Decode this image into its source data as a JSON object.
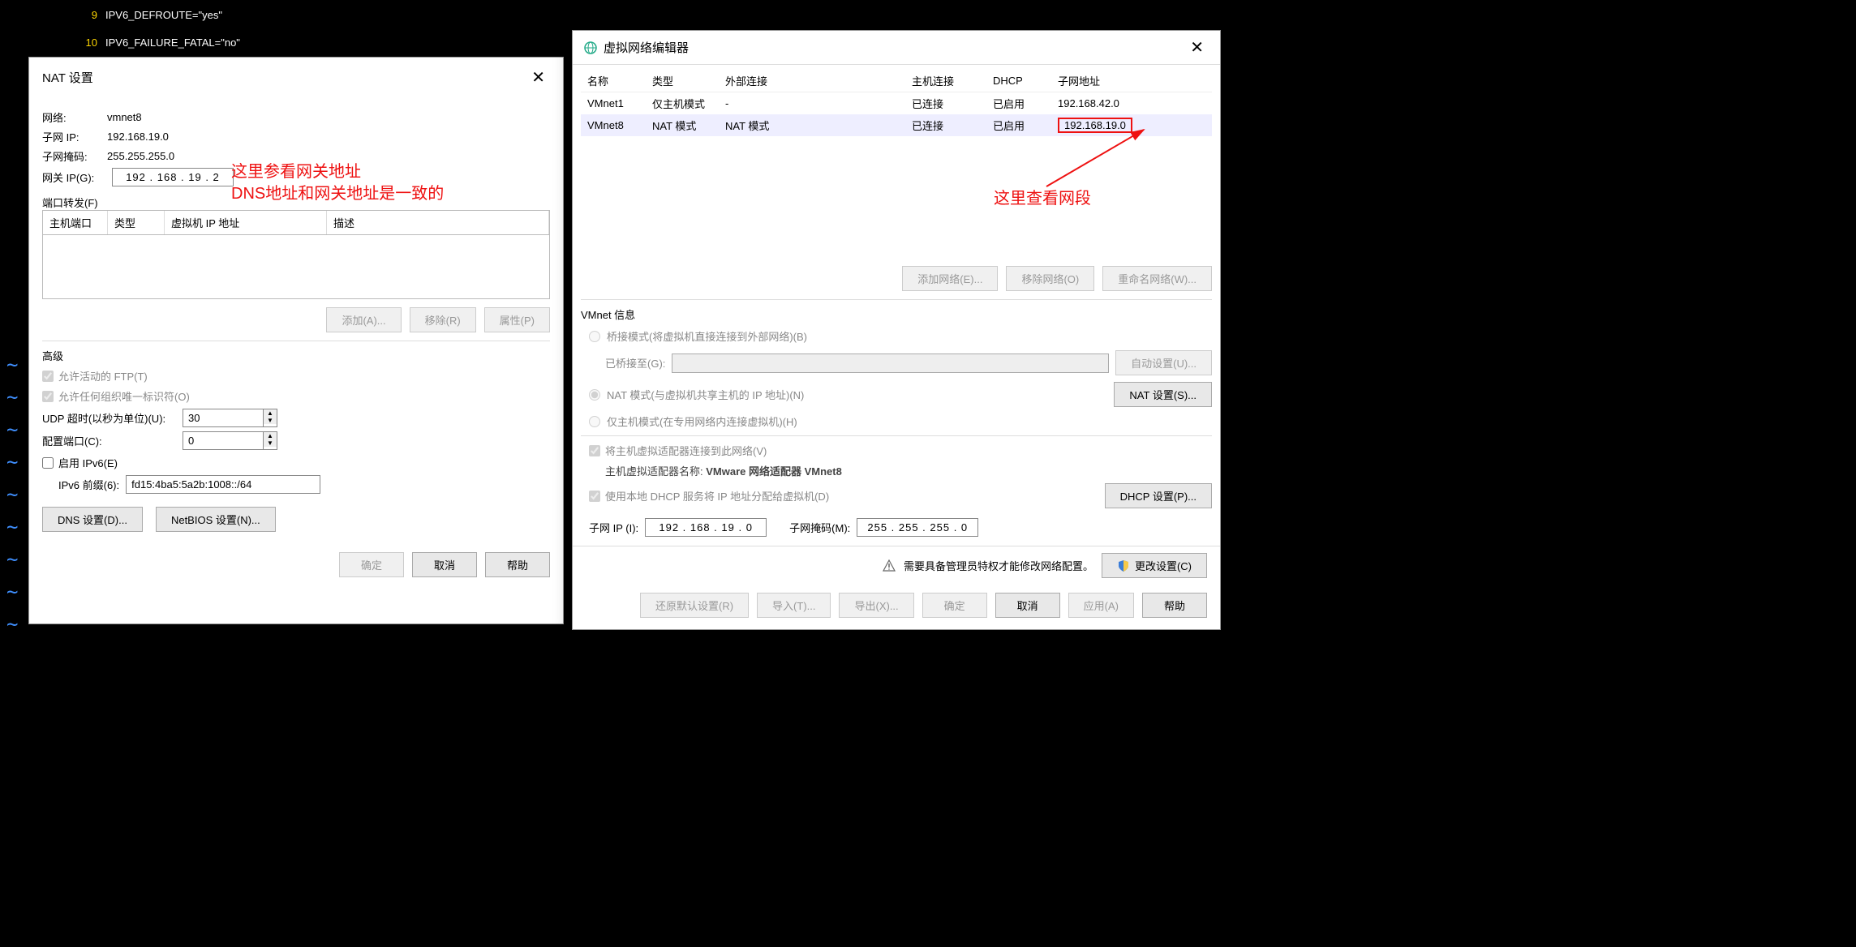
{
  "terminal": {
    "lines": [
      {
        "num": "9",
        "text": "IPV6_DEFROUTE=\"yes\""
      },
      {
        "num": "10",
        "text": "IPV6_FAILURE_FATAL=\"no\""
      }
    ]
  },
  "nat_dialog": {
    "title": "NAT 设置",
    "network_label": "网络:",
    "network_value": "vmnet8",
    "subnet_ip_label": "子网 IP:",
    "subnet_ip_value": "192.168.19.0",
    "subnet_mask_label": "子网掩码:",
    "subnet_mask_value": "255.255.255.0",
    "gateway_ip_label": "网关 IP(G):",
    "gateway_ip_value": "192 . 168 .  19  .  2",
    "port_forward_label": "端口转发(F)",
    "cols": {
      "host_port": "主机端口",
      "type": "类型",
      "vm_ip": "虚拟机 IP 地址",
      "desc": "描述"
    },
    "btns": {
      "add": "添加(A)...",
      "remove": "移除(R)",
      "props": "属性(P)"
    },
    "advanced_label": "高级",
    "allow_ftp": "允许活动的 FTP(T)",
    "allow_org": "允许任何组织唯一标识符(O)",
    "udp_timeout_label": "UDP 超时(以秒为单位)(U):",
    "udp_timeout_value": "30",
    "config_port_label": "配置端口(C):",
    "config_port_value": "0",
    "enable_ipv6": "启用 IPv6(E)",
    "ipv6_prefix_label": "IPv6 前缀(6):",
    "ipv6_prefix_value": "fd15:4ba5:5a2b:1008::/64",
    "dns_btn": "DNS 设置(D)...",
    "netbios_btn": "NetBIOS 设置(N)...",
    "ok": "确定",
    "cancel": "取消",
    "help": "帮助"
  },
  "annotations": {
    "gateway1": "这里参看网关地址",
    "gateway2": "DNS地址和网关地址是一致的",
    "segment": "这里查看网段"
  },
  "vne": {
    "title": "虚拟网络编辑器",
    "headers": {
      "name": "名称",
      "type": "类型",
      "ext": "外部连接",
      "host": "主机连接",
      "dhcp": "DHCP",
      "subnet": "子网地址"
    },
    "rows": [
      {
        "name": "VMnet1",
        "type": "仅主机模式",
        "ext": "-",
        "host": "已连接",
        "dhcp": "已启用",
        "subnet": "192.168.42.0"
      },
      {
        "name": "VMnet8",
        "type": "NAT 模式",
        "ext": "NAT 模式",
        "host": "已连接",
        "dhcp": "已启用",
        "subnet": "192.168.19.0"
      }
    ],
    "btns": {
      "add_net": "添加网络(E)...",
      "remove_net": "移除网络(O)",
      "rename_net": "重命名网络(W)..."
    },
    "info_label": "VMnet 信息",
    "bridge_mode": "桥接模式(将虚拟机直接连接到外部网络)(B)",
    "bridge_to": "已桥接至(G):",
    "auto_set": "自动设置(U)...",
    "nat_mode": "NAT 模式(与虚拟机共享主机的 IP 地址)(N)",
    "nat_set": "NAT 设置(S)...",
    "host_only": "仅主机模式(在专用网络内连接虚拟机)(H)",
    "connect_adapter": "将主机虚拟适配器连接到此网络(V)",
    "adapter_name_label": "主机虚拟适配器名称: ",
    "adapter_name_value": "VMware 网络适配器 VMnet8",
    "use_dhcp": "使用本地 DHCP 服务将 IP 地址分配给虚拟机(D)",
    "dhcp_set": "DHCP 设置(P)...",
    "subnet_ip_label": "子网 IP (I):",
    "subnet_ip_value": "192 . 168 .  19  .  0",
    "subnet_mask_label": "子网掩码(M):",
    "subnet_mask_value": "255 . 255 . 255 .  0",
    "admin_msg": "需要具备管理员特权才能修改网络配置。",
    "change_set": "更改设置(C)",
    "restore": "还原默认设置(R)",
    "import": "导入(T)...",
    "export": "导出(X)...",
    "ok": "确定",
    "cancel": "取消",
    "apply": "应用(A)",
    "help": "帮助"
  }
}
